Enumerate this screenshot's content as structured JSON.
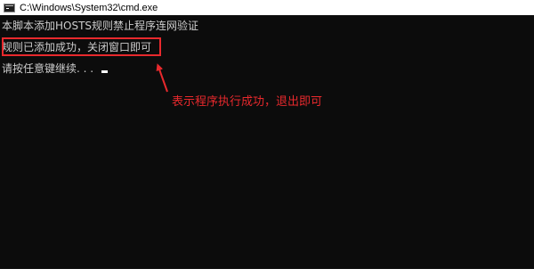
{
  "window": {
    "title": "C:\\Windows\\System32\\cmd.exe",
    "icon": "console-icon"
  },
  "console": {
    "lines": [
      "本脚本添加HOSTS规则禁止程序连网验证",
      "规则已添加成功，关闭窗口即可",
      "请按任意键继续. . . "
    ]
  },
  "annotation": {
    "text": "表示程序执行成功，退出即可",
    "color": "#e8292d"
  },
  "colors": {
    "console_bg": "#0c0c0c",
    "console_text": "#cccccc",
    "highlight": "#e8292d"
  }
}
